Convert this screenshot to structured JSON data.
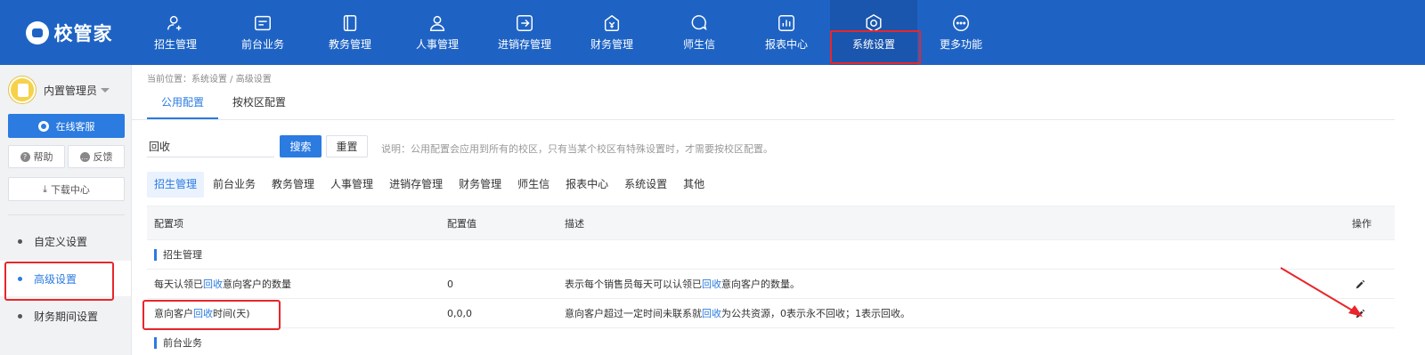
{
  "app": {
    "logo_text": "校管家",
    "accent_color": "#1e63c4",
    "highlight_color": "#e8262b"
  },
  "nav": [
    {
      "label": "招生管理",
      "icon": "user-add-icon"
    },
    {
      "label": "前台业务",
      "icon": "card-icon"
    },
    {
      "label": "教务管理",
      "icon": "book-icon"
    },
    {
      "label": "人事管理",
      "icon": "person-icon"
    },
    {
      "label": "进销存管理",
      "icon": "inout-icon"
    },
    {
      "label": "财务管理",
      "icon": "yen-bag-icon"
    },
    {
      "label": "师生信",
      "icon": "chat-bubble-icon"
    },
    {
      "label": "报表中心",
      "icon": "report-icon"
    },
    {
      "label": "系统设置",
      "icon": "settings-icon",
      "active": true
    },
    {
      "label": "更多功能",
      "icon": "more-icon"
    }
  ],
  "sidebar": {
    "user_name": "内置管理员",
    "service_label": "在线客服",
    "help_label": "帮助",
    "feedback_label": "反馈",
    "download_label": "下载中心",
    "menu": [
      {
        "label": "自定义设置"
      },
      {
        "label": "高级设置",
        "active": true
      },
      {
        "label": "财务期间设置"
      }
    ]
  },
  "main": {
    "breadcrumb": "当前位置：系统设置 / 高级设置",
    "tabs": [
      {
        "label": "公用配置",
        "active": true
      },
      {
        "label": "按校区配置"
      }
    ],
    "search": {
      "value": "回收",
      "search_label": "搜索",
      "reset_label": "重置",
      "hint": "说明：公用配置会应用到所有的校区，只有当某个校区有特殊设置时，才需要按校区配置。"
    },
    "categories": [
      {
        "label": "招生管理",
        "active": true
      },
      {
        "label": "前台业务"
      },
      {
        "label": "教务管理"
      },
      {
        "label": "人事管理"
      },
      {
        "label": "进销存管理"
      },
      {
        "label": "财务管理"
      },
      {
        "label": "师生信"
      },
      {
        "label": "报表中心"
      },
      {
        "label": "系统设置"
      },
      {
        "label": "其他"
      }
    ],
    "table": {
      "headers": {
        "item": "配置项",
        "value": "配置值",
        "desc": "描述",
        "action": "操作"
      },
      "group1": "招生管理",
      "rows": [
        {
          "item_pre": "每天认领已",
          "item_hl": "回收",
          "item_post": "意向客户的数量",
          "value": "0",
          "desc_pre": "表示每个销售员每天可以认领已",
          "desc_hl": "回收",
          "desc_post": "意向客户的数量。"
        },
        {
          "item_pre": "意向客户",
          "item_hl": "回收",
          "item_post": "时间(天)",
          "value": "0,0,0",
          "desc_pre": "意向客户超过一定时间未联系就",
          "desc_hl": "回收",
          "desc_post": "为公共资源，0表示永不回收；1表示回收。"
        }
      ],
      "group2": "前台业务"
    }
  }
}
